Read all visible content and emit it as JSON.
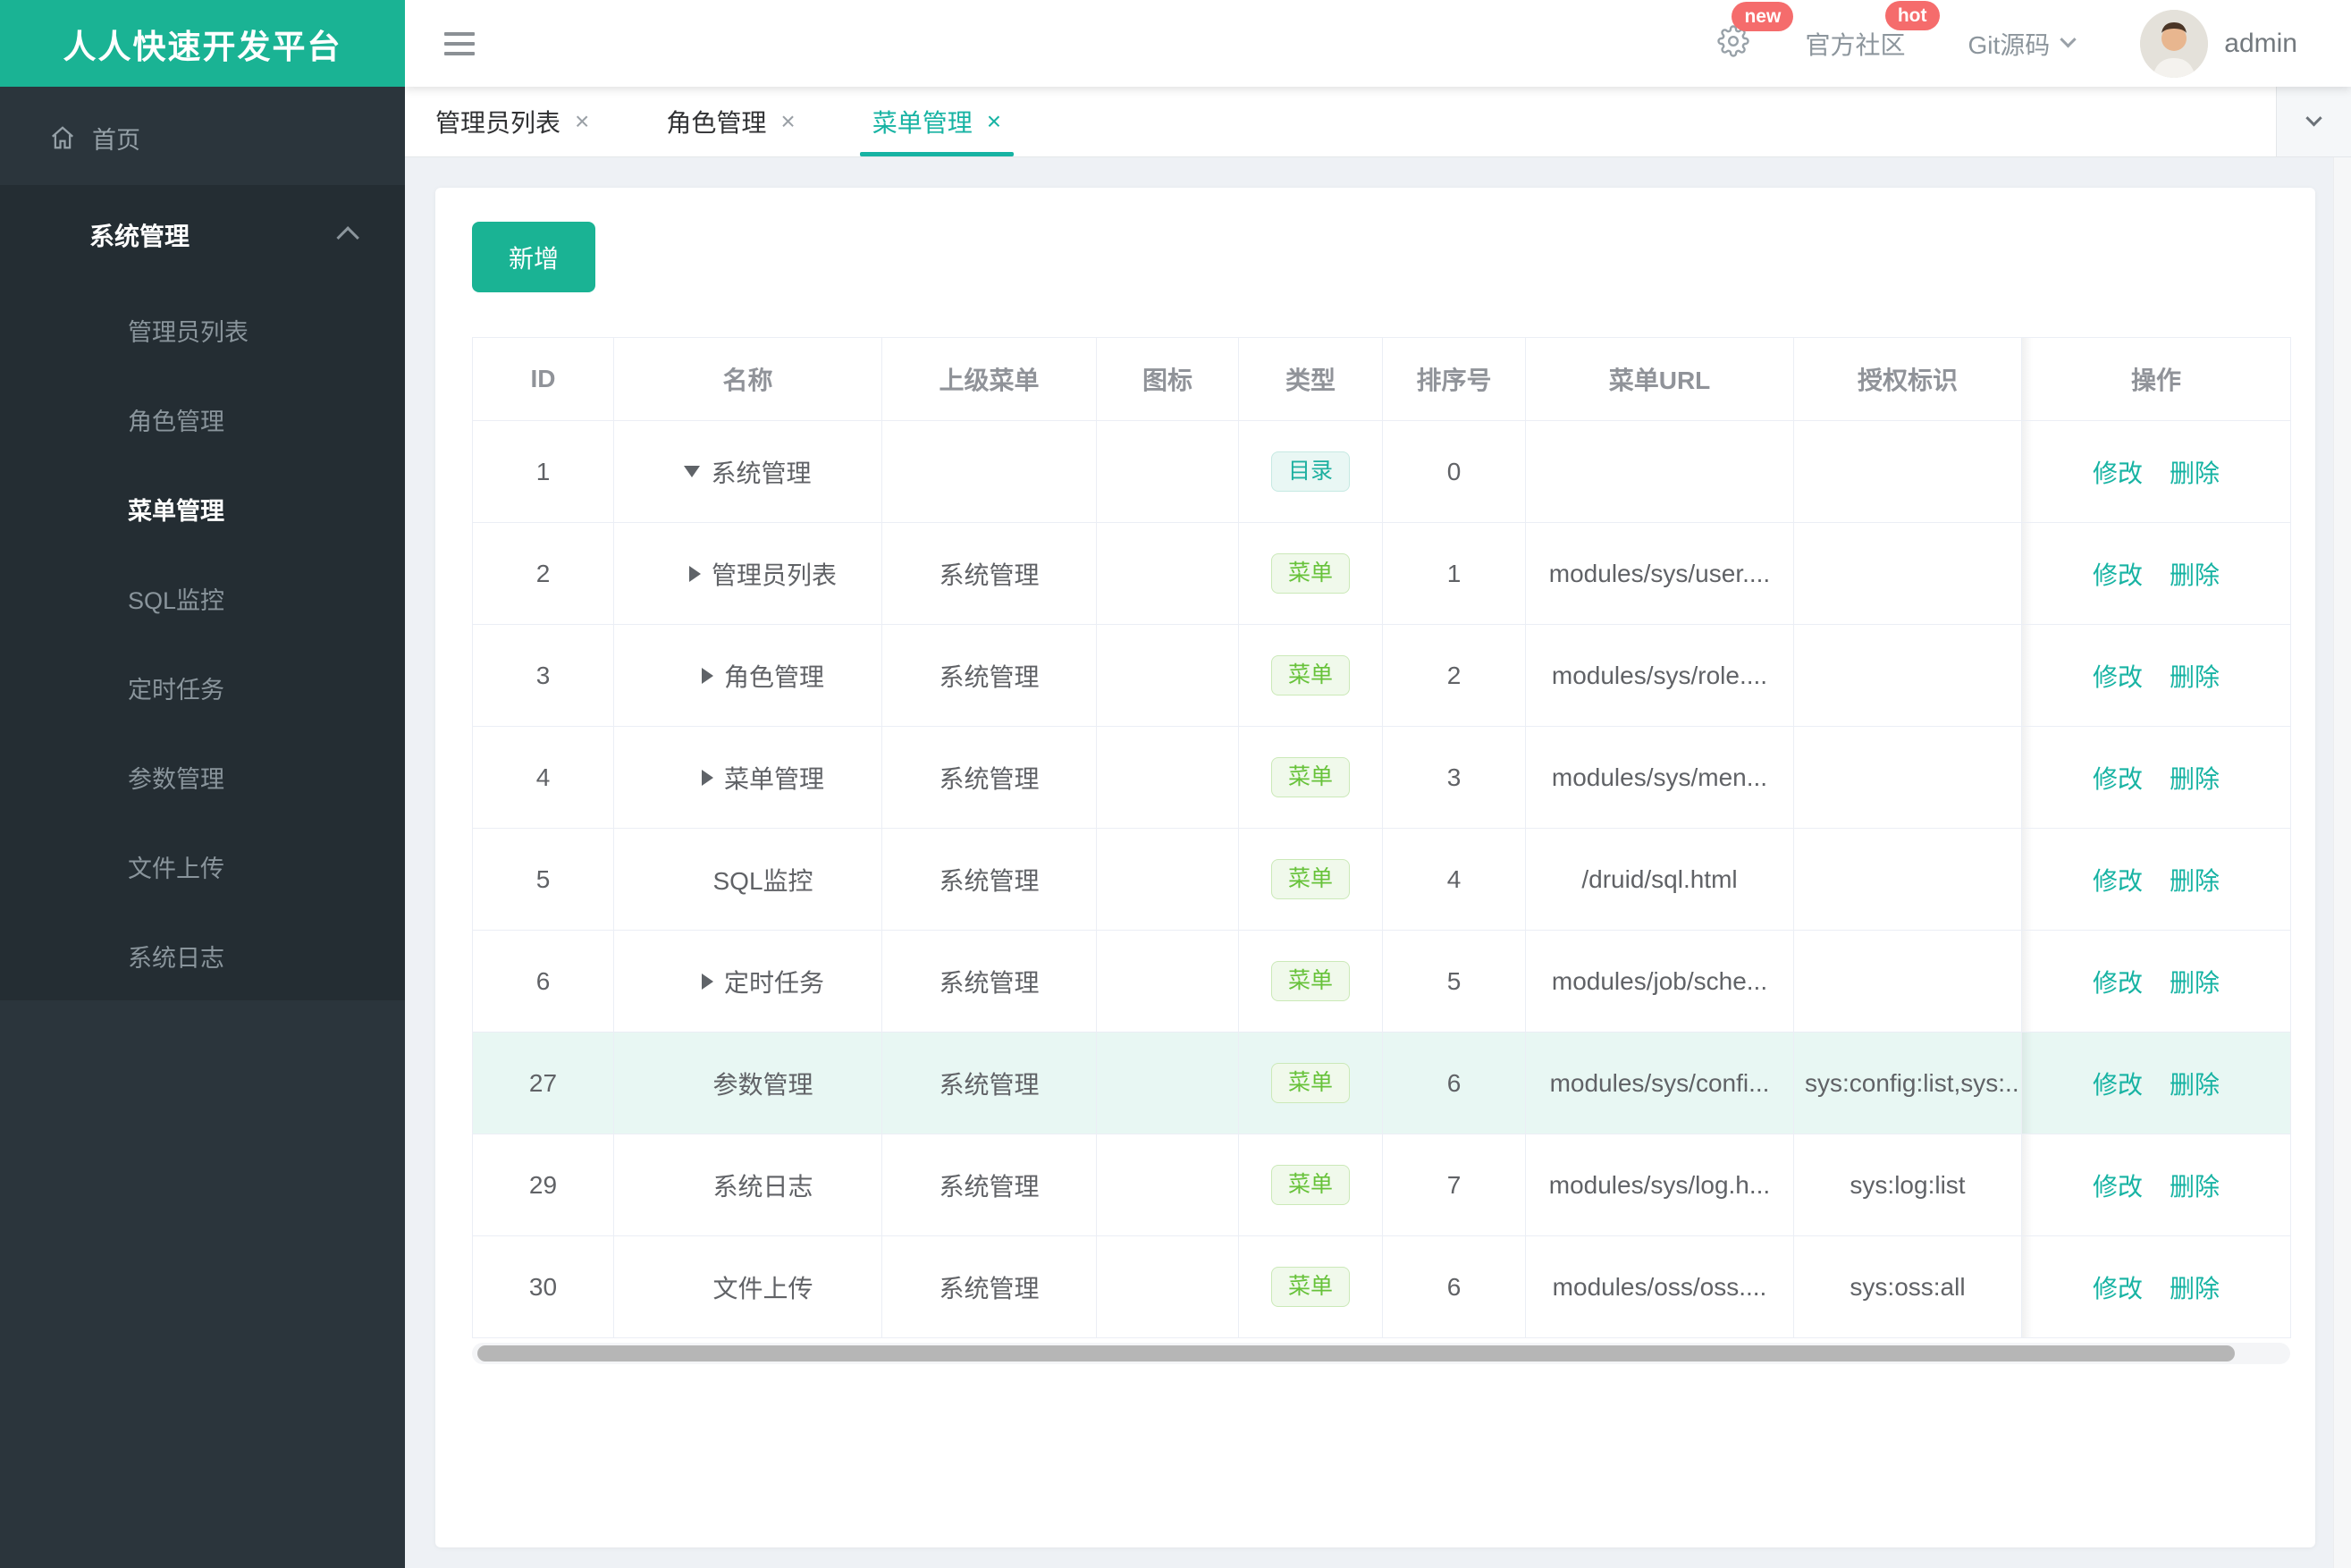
{
  "app": {
    "title": "人人快速开发平台"
  },
  "topbar": {
    "settings_badge": "new",
    "community_label": "官方社区",
    "community_badge": "hot",
    "git_label": "Git源码",
    "username": "admin"
  },
  "sidebar": {
    "home_label": "首页",
    "section_label": "系统管理",
    "items": [
      "管理员列表",
      "角色管理",
      "菜单管理",
      "SQL监控",
      "定时任务",
      "参数管理",
      "文件上传",
      "系统日志"
    ],
    "active_item": "菜单管理"
  },
  "tabs": {
    "close_glyph": "×",
    "items": [
      {
        "label": "管理员列表",
        "active": false
      },
      {
        "label": "角色管理",
        "active": false
      },
      {
        "label": "菜单管理",
        "active": true
      }
    ]
  },
  "toolbar": {
    "add_label": "新增"
  },
  "table": {
    "columns": [
      "ID",
      "名称",
      "上级菜单",
      "图标",
      "类型",
      "排序号",
      "菜单URL",
      "授权标识",
      "操作"
    ],
    "tag_labels": {
      "dir": "目录",
      "menu": "菜单"
    },
    "actions": {
      "edit_label": "修改",
      "delete_label": "删除"
    },
    "rows": [
      {
        "id": 1,
        "name": "系统管理",
        "expand": "expanded",
        "parent": "",
        "icon": "",
        "type": "dir",
        "order": 0,
        "url": "",
        "perms": "",
        "highlighted": false
      },
      {
        "id": 2,
        "name": "管理员列表",
        "expand": "collapsed",
        "parent": "系统管理",
        "icon": "",
        "type": "menu",
        "order": 1,
        "url": "modules/sys/user....",
        "perms": "",
        "highlighted": false
      },
      {
        "id": 3,
        "name": "角色管理",
        "expand": "collapsed",
        "parent": "系统管理",
        "icon": "",
        "type": "menu",
        "order": 2,
        "url": "modules/sys/role....",
        "perms": "",
        "highlighted": false
      },
      {
        "id": 4,
        "name": "菜单管理",
        "expand": "collapsed",
        "parent": "系统管理",
        "icon": "",
        "type": "menu",
        "order": 3,
        "url": "modules/sys/men...",
        "perms": "",
        "highlighted": false
      },
      {
        "id": 5,
        "name": "SQL监控",
        "expand": "none",
        "parent": "系统管理",
        "icon": "",
        "type": "menu",
        "order": 4,
        "url": "/druid/sql.html",
        "perms": "",
        "highlighted": false
      },
      {
        "id": 6,
        "name": "定时任务",
        "expand": "collapsed",
        "parent": "系统管理",
        "icon": "",
        "type": "menu",
        "order": 5,
        "url": "modules/job/sche...",
        "perms": "",
        "highlighted": false
      },
      {
        "id": 27,
        "name": "参数管理",
        "expand": "none",
        "parent": "系统管理",
        "icon": "",
        "type": "menu",
        "order": 6,
        "url": "modules/sys/confi...",
        "perms": "sys:config:list,sys:...",
        "highlighted": true
      },
      {
        "id": 29,
        "name": "系统日志",
        "expand": "none",
        "parent": "系统管理",
        "icon": "",
        "type": "menu",
        "order": 7,
        "url": "modules/sys/log.h...",
        "perms": "sys:log:list",
        "highlighted": false
      },
      {
        "id": 30,
        "name": "文件上传",
        "expand": "none",
        "parent": "系统管理",
        "icon": "",
        "type": "menu",
        "order": 6,
        "url": "modules/oss/oss....",
        "perms": "sys:oss:all",
        "highlighted": false
      }
    ]
  },
  "colors": {
    "brand": "#1ab394",
    "accent": "#17b3a3",
    "badge_red": "#f56c6c",
    "sidebar_bg": "#2b353c",
    "sidebar_submenu_bg": "#242d33",
    "row_highlight": "#e8f7f3",
    "tag_dir_text": "#1db0a0",
    "tag_menu_text": "#67c23a",
    "table_border": "#ebeef5"
  }
}
